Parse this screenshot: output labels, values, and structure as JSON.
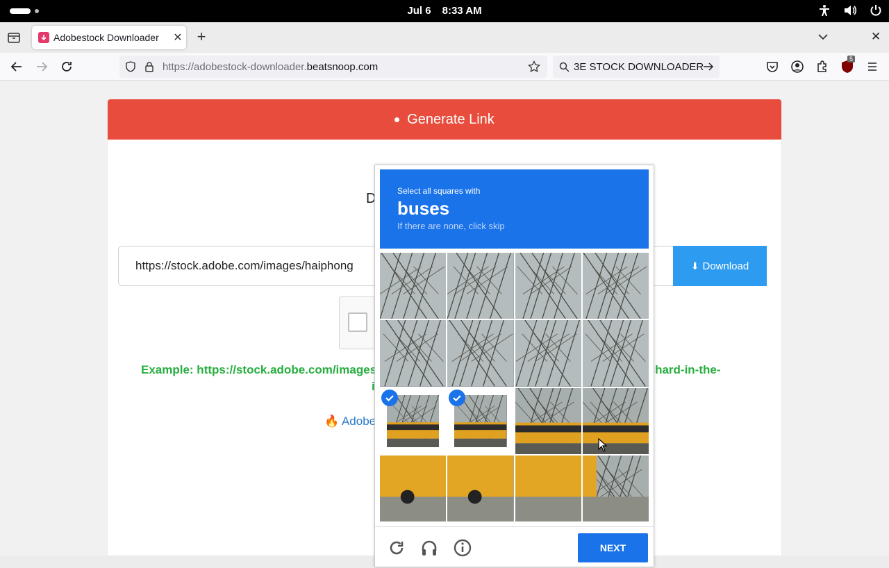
{
  "system": {
    "date": "Jul 6",
    "time": "8:33 AM"
  },
  "browser": {
    "tab_title": "Adobestock Downloader",
    "url_prefix": "https://adobestock-downloader.",
    "url_domain": "beatsnoop.com",
    "search_text": "3E STOCK DOWNLOADER",
    "ublock_count": "5"
  },
  "page": {
    "header": "Generate Link",
    "heading_fragment": "D",
    "url_value": "https://stock.adobe.com/images/haiphong",
    "download_label": "Download",
    "example_left": "Example: https://stock.adobe.com/images/",
    "example_right": "rchard-in-the-",
    "example_cont": "i",
    "link_fragment": "Adobe"
  },
  "captcha": {
    "instruction_small": "Select all squares with",
    "target": "buses",
    "hint": "If there are none, click skip",
    "next_label": "NEXT",
    "selected_tiles": [
      8,
      9
    ]
  },
  "colors": {
    "header": "#e74c3c",
    "download": "#2d9bf0",
    "captcha_blue": "#1a73e8",
    "example": "#27ae3f"
  }
}
